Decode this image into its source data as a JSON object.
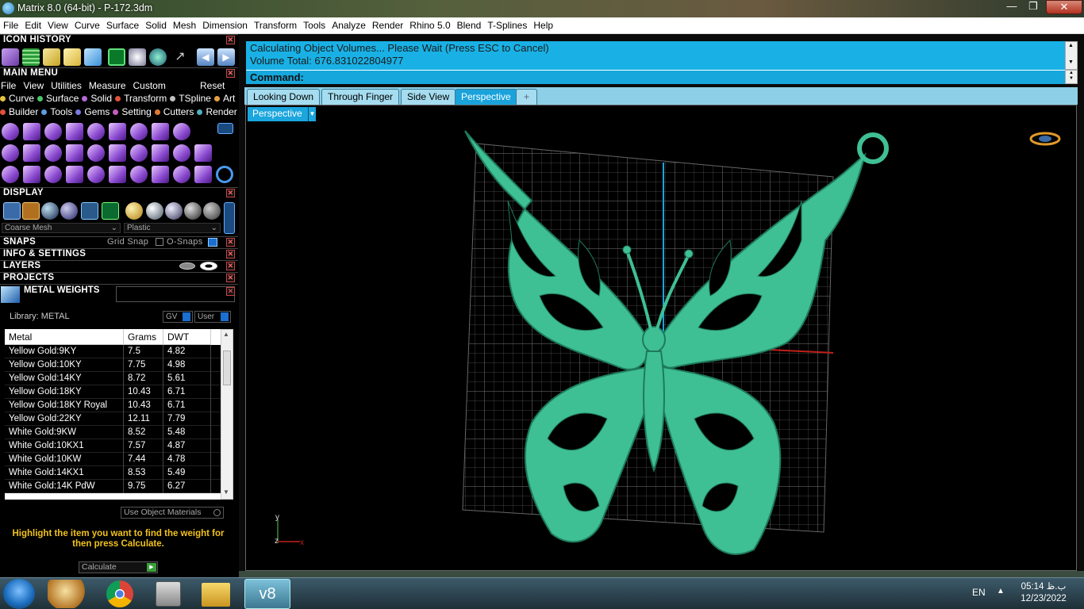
{
  "window": {
    "title": "Matrix 8.0 (64-bit) - P-172.3dm"
  },
  "menubar": [
    "File",
    "Edit",
    "View",
    "Curve",
    "Surface",
    "Solid",
    "Mesh",
    "Dimension",
    "Transform",
    "Tools",
    "Analyze",
    "Render",
    "Rhino 5.0",
    "Blend",
    "T-Splines",
    "Help"
  ],
  "panels": {
    "icon_history": "ICON HISTORY",
    "main_menu": "MAIN MENU",
    "main_menu_items": [
      "File",
      "View",
      "Utilities",
      "Measure",
      "Custom"
    ],
    "main_menu_reset": "Reset",
    "categories_row1": [
      {
        "label": "Curve",
        "color": "#e6c440"
      },
      {
        "label": "Surface",
        "color": "#49c66a"
      },
      {
        "label": "Solid",
        "color": "#b66bd8"
      },
      {
        "label": "Transform",
        "color": "#e0503a"
      },
      {
        "label": "TSpline",
        "color": "#c0c0c0"
      },
      {
        "label": "Art",
        "color": "#e6a040"
      }
    ],
    "categories_row2": [
      {
        "label": "Builder",
        "color": "#e0503a"
      },
      {
        "label": "Tools",
        "color": "#5c9ee0"
      },
      {
        "label": "Gems",
        "color": "#7a7ae0"
      },
      {
        "label": "Setting",
        "color": "#c060c0"
      },
      {
        "label": "Cutters",
        "color": "#e07a30"
      },
      {
        "label": "Render",
        "color": "#50b0c0"
      }
    ],
    "display": "DISPLAY",
    "display_mesh": "Coarse Mesh",
    "display_material": "Plastic",
    "snaps": "SNAPS",
    "grid_snap": "Grid Snap",
    "o_snaps": "O-Snaps",
    "info_settings": "INFO & SETTINGS",
    "layers": "LAYERS",
    "projects": "PROJECTS"
  },
  "metal_weights": {
    "title": "METAL WEIGHTS",
    "library": "Library: METAL",
    "gv": "GV",
    "user": "User",
    "columns": [
      "Metal",
      "Grams",
      "DWT"
    ],
    "rows": [
      [
        "Yellow Gold:9KY",
        "7.5",
        "4.82"
      ],
      [
        "Yellow Gold:10KY",
        "7.75",
        "4.98"
      ],
      [
        "Yellow Gold:14KY",
        "8.72",
        "5.61"
      ],
      [
        "Yellow Gold:18KY",
        "10.43",
        "6.71"
      ],
      [
        "Yellow Gold:18KY Royal",
        "10.43",
        "6.71"
      ],
      [
        "Yellow Gold:22KY",
        "12.11",
        "7.79"
      ],
      [
        "White Gold:9KW",
        "8.52",
        "5.48"
      ],
      [
        "White Gold:10KX1",
        "7.57",
        "4.87"
      ],
      [
        "White Gold:10KW",
        "7.44",
        "4.78"
      ],
      [
        "White Gold:14KX1",
        "8.53",
        "5.49"
      ],
      [
        "White Gold:14K PdW",
        "9.75",
        "6.27"
      ]
    ],
    "use_object_materials": "Use Object Materials",
    "hint": "Highlight the item you want to find the weight for then press Calculate.",
    "calculate": "Calculate"
  },
  "command": {
    "history_line1": "Calculating Object Volumes... Please Wait (Press ESC to Cancel)",
    "history_line2": "Volume Total: 676.831022804977",
    "prompt": "Command:"
  },
  "tabs": [
    "Looking Down",
    "Through Finger",
    "Side View",
    "Perspective"
  ],
  "tab_add": "+",
  "viewport": {
    "label": "Perspective",
    "model_color": "#3fbf94",
    "axis_y": "y",
    "axis_z": "z",
    "axis_x": "x"
  },
  "taskbar": {
    "lang": "EN",
    "time": "05:14 ب.ظ",
    "date": "12/23/2022"
  }
}
